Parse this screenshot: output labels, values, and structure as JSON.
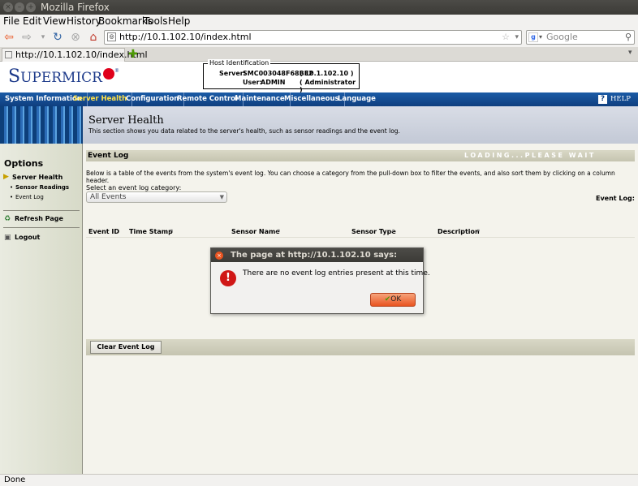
{
  "window": {
    "title": "Mozilla Firefox"
  },
  "menu": [
    "File",
    "Edit",
    "View",
    "History",
    "Bookmarks",
    "Tools",
    "Help"
  ],
  "nav": {
    "url": "http://10.1.102.10/index.html",
    "search_placeholder": "Google"
  },
  "tab": {
    "title": "http://10.1.102.10/index.html"
  },
  "brand": {
    "logo": "Supermicro",
    "accent": "#e0001b"
  },
  "host": {
    "legend": "Host Identification",
    "server_label": "Server:",
    "server_value": "SMC003048F68BE2",
    "server_ip": "( 10.1.102.10 )",
    "user_label": "User:",
    "user_value": "ADMIN",
    "user_role": "( Administrator )"
  },
  "topnav": {
    "items": [
      "System Information",
      "Server Health",
      "Configuration",
      "Remote Control",
      "Maintenance",
      "Miscellaneous",
      "Language"
    ],
    "active": "Server Health",
    "help": "HELP"
  },
  "banner": {
    "title": "Server Health",
    "subtitle": "This section shows you data related to the server's health, such as sensor readings and the event log."
  },
  "sidebar": {
    "heading": "Options",
    "section": "Server Health",
    "sub_items": [
      "Sensor Readings",
      "Event Log"
    ],
    "refresh": "Refresh Page",
    "logout": "Logout"
  },
  "main": {
    "title": "Event Log",
    "loading": "LOADING...PLEASE WAIT",
    "description": "Below is a table of the events from the system's event log. You can choose a category from the pull-down box to filter the events, and also sort them by clicking on a column header.",
    "select_label": "Select an event log category:",
    "select_value": "All Events",
    "event_log_label": "Event Log:",
    "columns": [
      "Event ID",
      "Time Stamp",
      "Sensor Name",
      "Sensor Type",
      "Description"
    ],
    "clear_button": "Clear Event Log"
  },
  "dialog": {
    "title": "The page at http://10.1.102.10 says:",
    "message": "There are no event log entries present at this time.",
    "ok": "OK"
  },
  "status": {
    "text": "Done"
  }
}
